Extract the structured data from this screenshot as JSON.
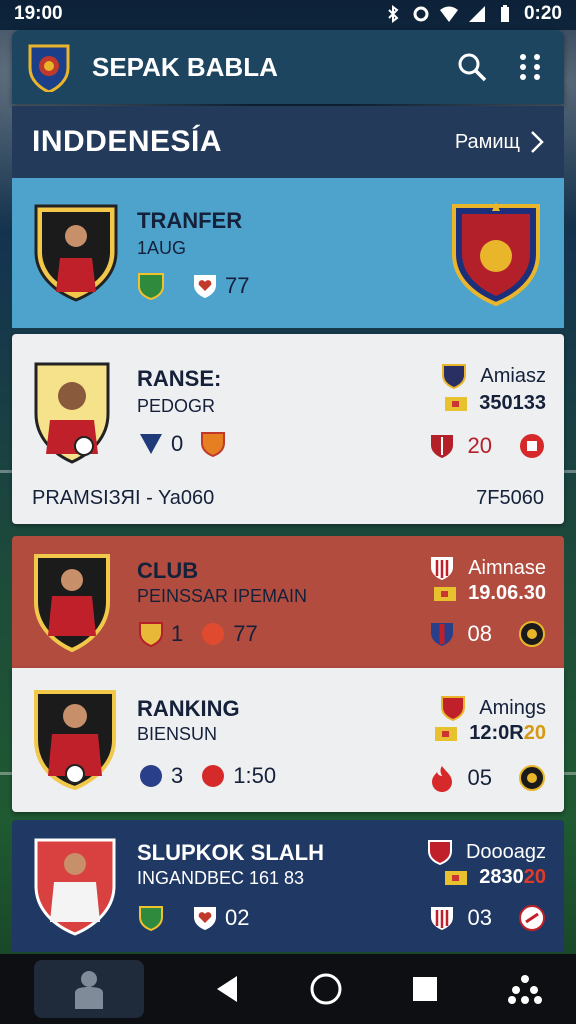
{
  "status": {
    "time": "19:00",
    "clock_right": "0:20"
  },
  "appbar": {
    "title": "SEPAK BABLA"
  },
  "section": {
    "title": "INDDENESÍA",
    "link": "Рамищ"
  },
  "cards": [
    {
      "name": "TRANFER",
      "sub": "1AUG",
      "stat_a": "",
      "stat_b": "77"
    },
    {
      "name": "RANSE:",
      "sub": "PEDOGR",
      "stat_a": "0",
      "stat_b": "",
      "right_title": "Amiasz",
      "right_value": "350133",
      "right_stat": "20",
      "footer_left": "PRAMSIЗЯI - Ya060",
      "footer_right": "7F5060"
    },
    {
      "name": "CLUB",
      "sub": "PEINSSAR IPEMAIN",
      "stat_a": "1",
      "stat_b": "77",
      "right_title": "Aimnase",
      "right_value": "19.06.30",
      "right_stat": "08"
    },
    {
      "name": "RANKING",
      "sub": "BIENSUN",
      "stat_a": "3",
      "stat_b": "1:50",
      "right_title": "Amings",
      "right_value": "12:0R",
      "right_value_accent": "20",
      "right_stat": "05"
    },
    {
      "name": "SLUPKOK SLALH",
      "sub": "INGANDBEC 161 83",
      "stat_a": "",
      "stat_b": "02",
      "right_title": "Doooagz",
      "right_value": "2830",
      "right_value_accent": "20",
      "right_stat": "03"
    }
  ],
  "colors": {
    "appbar": "#1e4560",
    "section": "#233a5a",
    "card_blue": "#4da3cc",
    "card_red": "#b24c3f",
    "card_navy": "#1f3864",
    "card_light": "#eeeff1"
  },
  "icons": [
    "bluetooth-icon",
    "sync-icon",
    "wifi-icon",
    "signal-icon",
    "battery-icon",
    "search-icon",
    "more-vert-icon",
    "chevron-right-icon",
    "back-icon",
    "home-icon",
    "recents-icon",
    "profile-icon",
    "apps-icon"
  ]
}
